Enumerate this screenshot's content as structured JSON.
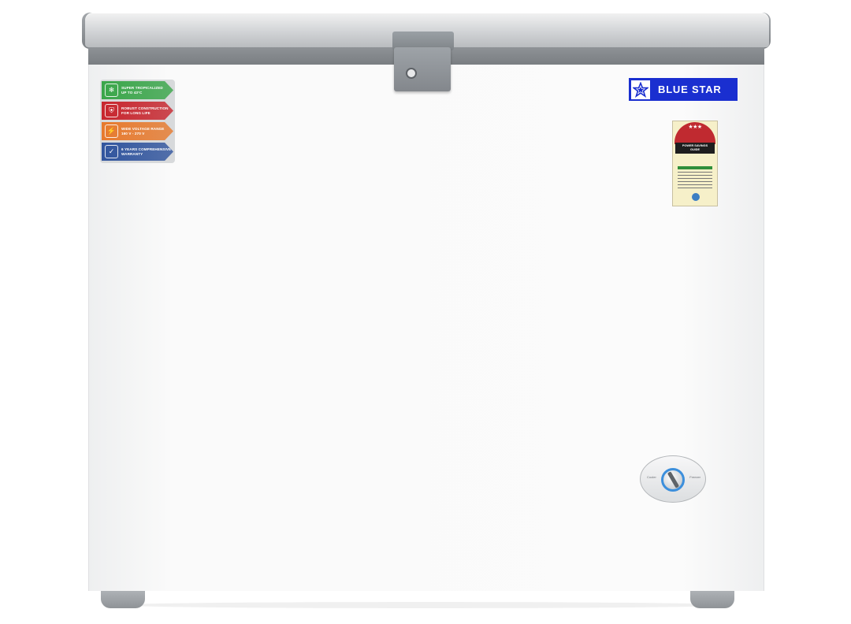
{
  "product": {
    "brand_logo_text": "BLUE STAR",
    "brand_color": "#1a2fd0",
    "features": [
      {
        "label": "SUPER TROPICALIZED\nUP TO 43°C",
        "icon": "thermometer-icon",
        "color": "#3aa64a"
      },
      {
        "label": "ROBUST CONSTRUCTION\nFOR LONG LIFE",
        "icon": "shield-icon",
        "color": "#c8262e"
      },
      {
        "label": "WIDE VOLTAGE RANGE\n160 V - 270 V",
        "icon": "voltage-icon",
        "color": "#e77a2e"
      },
      {
        "label": "6 YEARS COMPREHENSIVE\nWARRANTY",
        "icon": "warranty-shield-icon",
        "color": "#31559e"
      }
    ],
    "energy_label": {
      "stars_text": "★★★",
      "title": "POWER SAVINGS\nGUIDE"
    },
    "thermostat": {
      "left_label": "Cooler",
      "right_label": "Freezer"
    }
  }
}
